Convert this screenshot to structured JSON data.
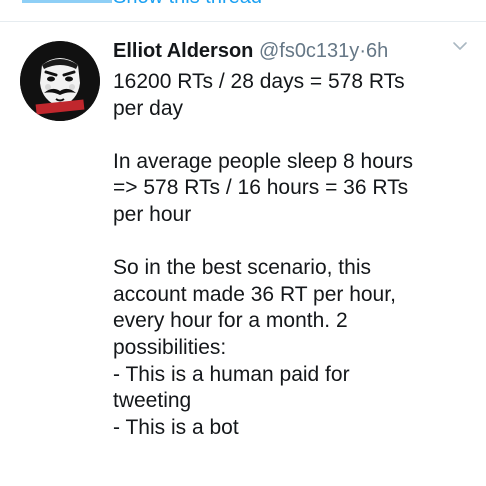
{
  "thread": {
    "show_thread_label": "Show this thread"
  },
  "tweet": {
    "author_name": "Elliot Alderson",
    "handle": "@fs0c131y",
    "separator": "·",
    "time": "6h",
    "avatar_label": "FSOCIETY",
    "text": "16200 RTs / 28 days = 578 RTs\nper day\n\nIn average people sleep 8 hours\n=> 578 RTs / 16 hours = 36 RTs\nper hour\n\nSo in the best scenario, this\naccount made 36 RT per hour,\nevery hour for a month. 2\npossibilities:\n- This is a human paid for\ntweeting\n- This is a bot"
  },
  "icons": {
    "more_menu": "chevron-down-icon",
    "avatar": "fsociety-mask-logo"
  },
  "colors": {
    "link": "#1da1f2",
    "text": "#14171a",
    "secondary": "#657786",
    "avatar_bg": "#111111",
    "badge": "#c0272d"
  }
}
